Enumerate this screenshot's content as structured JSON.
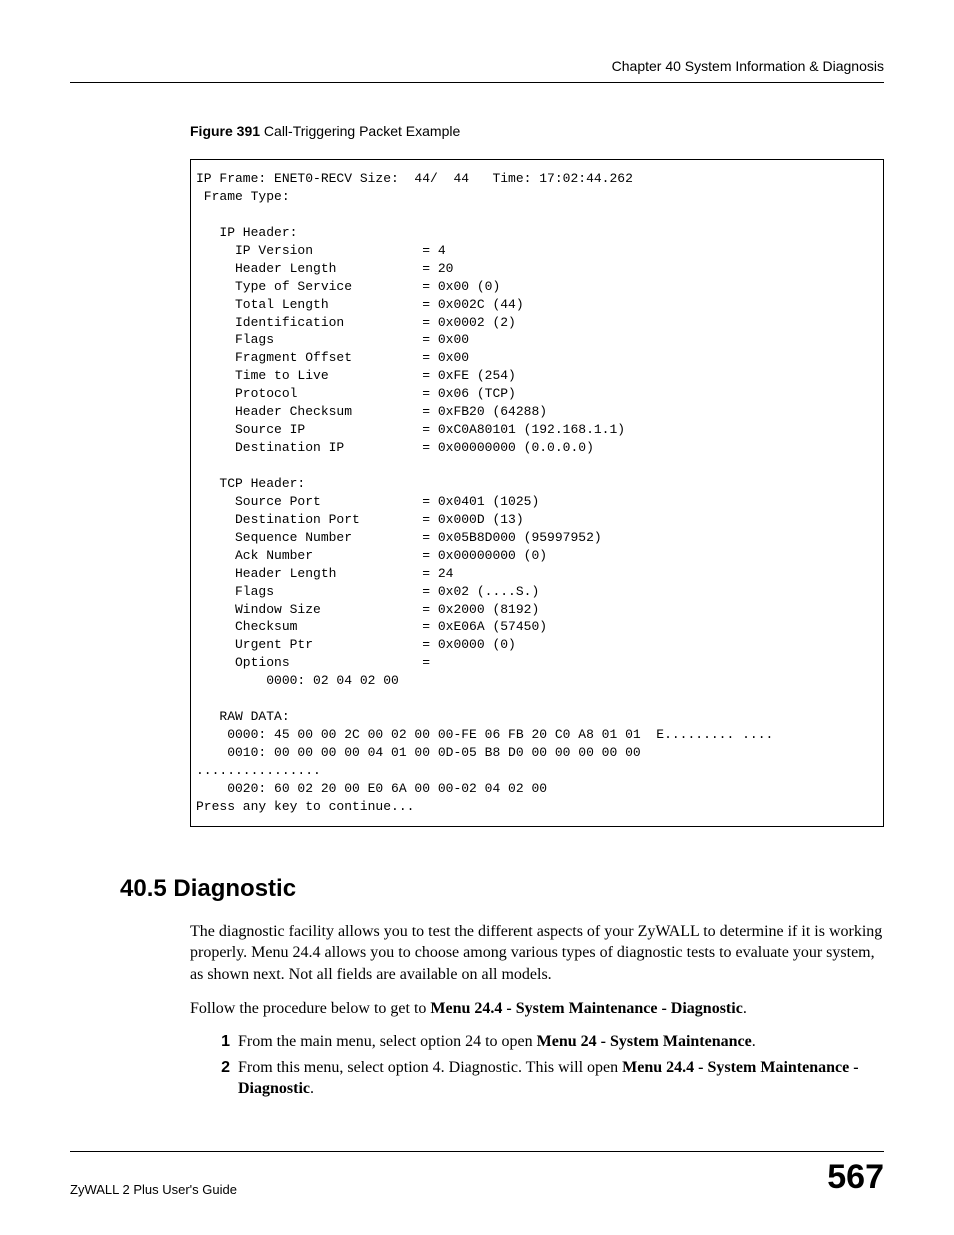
{
  "header": {
    "chapter_title": "Chapter 40 System Information & Diagnosis"
  },
  "figure": {
    "label_bold": "Figure 391",
    "label_text": "   Call-Triggering Packet Example",
    "code": "IP Frame: ENET0-RECV Size:  44/  44   Time: 17:02:44.262\n Frame Type:\n\n   IP Header:\n     IP Version              = 4\n     Header Length           = 20\n     Type of Service         = 0x00 (0)\n     Total Length            = 0x002C (44)\n     Identification          = 0x0002 (2)\n     Flags                   = 0x00\n     Fragment Offset         = 0x00\n     Time to Live            = 0xFE (254)\n     Protocol                = 0x06 (TCP)\n     Header Checksum         = 0xFB20 (64288)\n     Source IP               = 0xC0A80101 (192.168.1.1)\n     Destination IP          = 0x00000000 (0.0.0.0)\n\n   TCP Header:\n     Source Port             = 0x0401 (1025)\n     Destination Port        = 0x000D (13)\n     Sequence Number         = 0x05B8D000 (95997952)\n     Ack Number              = 0x00000000 (0)\n     Header Length           = 24\n     Flags                   = 0x02 (....S.)\n     Window Size             = 0x2000 (8192)\n     Checksum                = 0xE06A (57450)\n     Urgent Ptr              = 0x0000 (0)\n     Options                 =\n         0000: 02 04 02 00\n\n   RAW DATA:\n    0000: 45 00 00 2C 00 02 00 00-FE 06 FB 20 C0 A8 01 01  E......... ....\n    0010: 00 00 00 00 04 01 00 0D-05 B8 D0 00 00 00 00 00  \n................\n    0020: 60 02 20 00 E0 6A 00 00-02 04 02 00\nPress any key to continue..."
  },
  "section": {
    "heading": "40.5  Diagnostic",
    "para1": "The diagnostic facility allows you to test the different aspects of your ZyWALL to determine if it is working properly. Menu 24.4 allows you to choose among various types of diagnostic tests to evaluate your system, as shown next. Not all fields are available on all models.",
    "para2_pre": "Follow the procedure below to get to ",
    "para2_bold": "Menu 24.4 - System Maintenance - Diagnostic",
    "para2_post": ".",
    "list": {
      "item1": {
        "num": "1",
        "text_pre": "From the main menu, select option 24 to open ",
        "text_bold": "Menu 24 - System Maintenance",
        "text_post": "."
      },
      "item2": {
        "num": "2",
        "text_pre": "From this menu, select option 4. Diagnostic. This will open ",
        "text_bold": "Menu 24.4 - System Maintenance - Diagnostic",
        "text_post": "."
      }
    }
  },
  "footer": {
    "guide": "ZyWALL 2 Plus User's Guide",
    "page": "567"
  }
}
